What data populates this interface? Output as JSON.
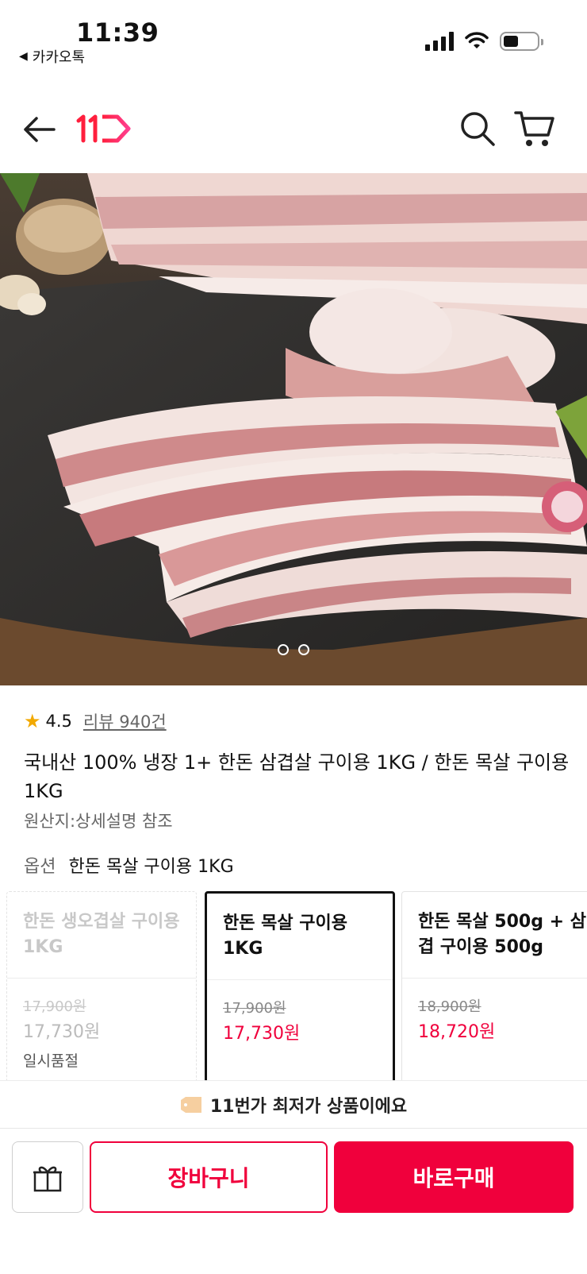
{
  "status_bar": {
    "time": "11:39",
    "back_app": "카카오톡"
  },
  "nav": {
    "logo_text": "11",
    "icons": [
      "back-arrow-icon",
      "logo-icon",
      "search-icon",
      "cart-icon"
    ]
  },
  "gallery": {
    "page_count": 2,
    "current_page": 1
  },
  "product": {
    "rating": "4.5",
    "review_text": "리뷰 940건",
    "title": "국내산 100% 냉장 1+ 한돈 삼겹살 구이용 1KG / 한돈 목살 구이용 1KG",
    "origin": "원산지:상세설명 참조",
    "option_label": "옵션",
    "selected_option": "한돈 목살 구이용 1KG"
  },
  "options": [
    {
      "name": "한돈 생오겹살 구이용 1KG",
      "orig_price": "17,900원",
      "price": "17,730원",
      "status": "일시품절",
      "state": "disabled"
    },
    {
      "name": "한돈 목살 구이용 1KG",
      "orig_price": "17,900원",
      "price": "17,730원",
      "status": "",
      "state": "selected"
    },
    {
      "name": "한돈 목살 500g + 삼겹 구이용 500g",
      "orig_price": "18,900원",
      "price": "18,720원",
      "status": "",
      "state": "normal"
    }
  ],
  "banner": {
    "text": "11번가 최저가 상품이에요"
  },
  "bottom": {
    "cart_label": "장바구니",
    "buy_label": "바로구매"
  },
  "colors": {
    "accent": "#f0003c",
    "star": "#f2a900"
  }
}
